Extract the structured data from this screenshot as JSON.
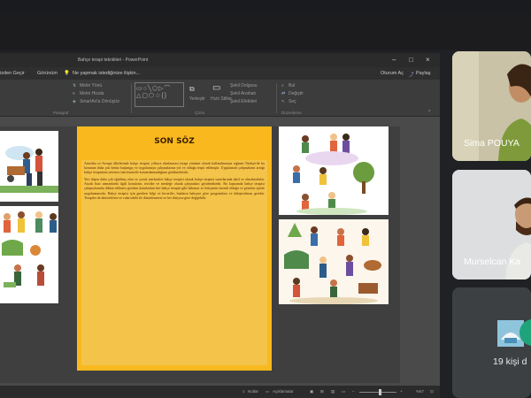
{
  "ppt": {
    "title": "Bahçe terapi teknikleri - PowerPoint",
    "menu": {
      "left": "izden Geçir",
      "view": "Görünüm",
      "search": "Ne yapmak istediğinize ilişkin...",
      "share_comment": "Oturum Aç",
      "share": "Paylaş"
    },
    "ribbon": {
      "textdir": "Metin Yönü",
      "align": "Metni Hizala",
      "smartart": "SmartArt'a Dönüştür",
      "paragraph": "Paragraf",
      "arrange": "Yerleştir",
      "quickstyles": "Hızlı Stiller",
      "shapefill": "Şekil Dolgusu",
      "shapeoutline": "Şekil Anahatı",
      "shapeeffects": "Şekil Efektleri",
      "draw": "Çizim",
      "find": "Bul",
      "replace": "Değiştir",
      "select": "Seç",
      "editing": "Düzenleme"
    },
    "status": {
      "notes": "Notlar",
      "comments": "Açıklamalar",
      "zoom": "%67"
    }
  },
  "slide": {
    "heading": "SON SÖZ",
    "paragraphs": [
      "Amerika ve Avrupa ülkelerinde bahçe terapisi yıllarca uluslararası terapi yöntemi olarak kullanılmasına rağmen Türkiye'de bu konunun daha çok henüz başlangıç ve uygulamaya çalışmalarına yol ve olduğu tespit edilmiştir. Uygulamalı çalışmaların arttığı bahçe terapisinin yetenice tüm hizmetle konumlanmadığının görülmektedir.",
      "Yeri düşen daha çok eğitilmiş olan ve çocuk merkezleri bahçe terapisi olarak bahçe terapisi sınavlarında aktif ve olmaktadırlar. Ancak bazı uzmanlarda ilgili konuların, tecrübe ve mesleğe olarak çalışmaları görülmektedir. Bu kapsamda bahçe terapisi çalışmalarında dikkat edilmesi gereken konulardan biri bahçe terapisi gibi bakımın ve iletişimin önemli olduğu ve gözetim içinde uygulanmasıdır. Bahçe terapisi için gereken bilgi ve beceriler, bunların bahçeye göre programlara ve dalaştırılması gerekir. Terapiler de aktivitelerin ve vaka takibi ile düzenlenmesi ve her ihtiyaca göre değişebilir."
    ]
  },
  "participants": [
    {
      "name": "Sima POUYA"
    },
    {
      "name": "Murselcan Ka"
    }
  ],
  "others": {
    "count_label": "19 kişi d"
  }
}
